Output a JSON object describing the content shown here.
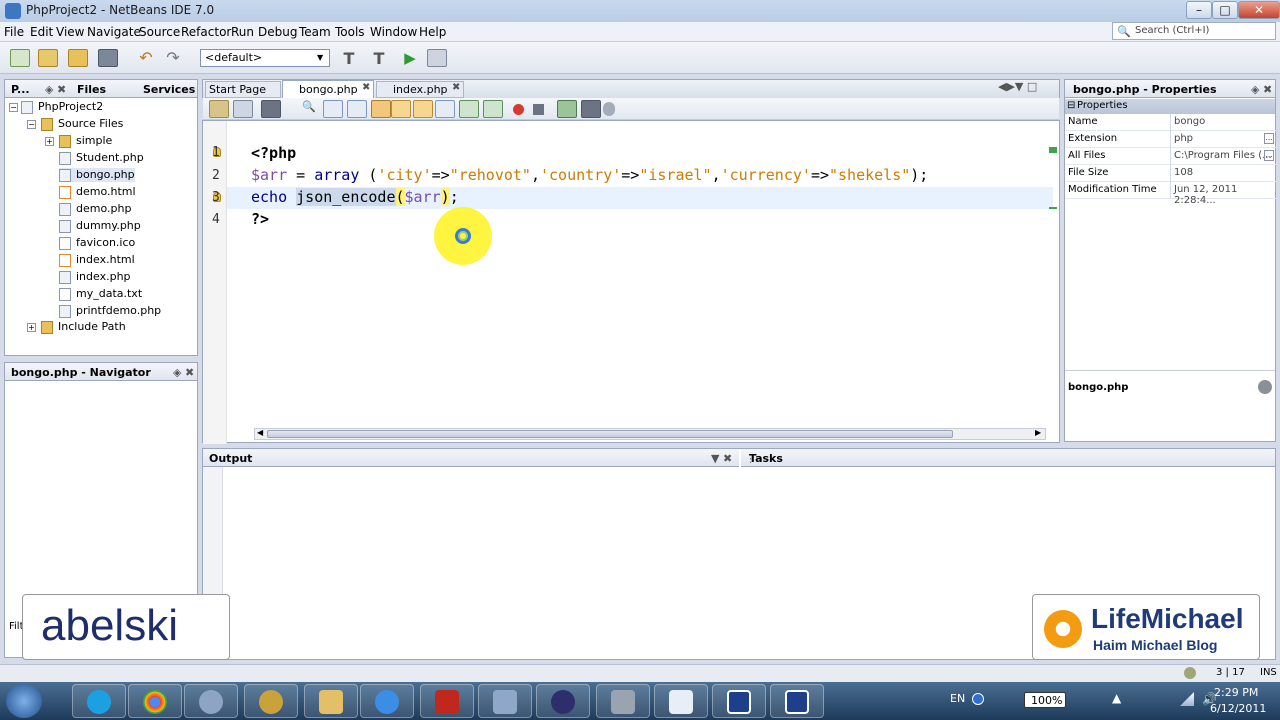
{
  "window": {
    "title": "PhpProject2 - NetBeans IDE 7.0",
    "min": "–",
    "max": "□",
    "close": "✕"
  },
  "menu": [
    "File",
    "Edit",
    "View",
    "Navigate",
    "Source",
    "Refactor",
    "Run",
    "Debug",
    "Team",
    "Tools",
    "Window",
    "Help"
  ],
  "search": {
    "placeholder": "Search (Ctrl+I)"
  },
  "toolbar": {
    "config": "<default>"
  },
  "projects_panel": {
    "tabs": [
      "P...",
      "Files",
      "Services"
    ],
    "project": "PhpProject2",
    "source_files": "Source Files",
    "folder": "simple",
    "files": [
      "Student.php",
      "bongo.php",
      "demo.html",
      "demo.php",
      "dummy.php",
      "favicon.ico",
      "index.html",
      "index.php",
      "my_data.txt",
      "printfdemo.php"
    ],
    "include_path": "Include Path"
  },
  "navigator": {
    "title": "bongo.php - Navigator"
  },
  "filter_label": "Filt",
  "editor": {
    "tabs": [
      "Start Page",
      "bongo.php",
      "index.php"
    ],
    "line_numbers": [
      "1",
      "2",
      "3",
      "4"
    ],
    "code": {
      "l1": "<?php",
      "l2_var": "$arr",
      "l2_eq": " = ",
      "l2_kw": "array",
      "l2_open": " (",
      "l2_s1": "'city'",
      "l2_a1": "=>",
      "l2_s2": "\"rehovot\"",
      "l2_c1": ",",
      "l2_s3": "'country'",
      "l2_a2": "=>",
      "l2_s4": "\"israel\"",
      "l2_c2": ",",
      "l2_s5": "'currency'",
      "l2_a3": "=>",
      "l2_s6": "\"shekels\"",
      "l2_close": ");",
      "l3_kw": "echo",
      "l3_fn": "json_encode",
      "l3_po": "(",
      "l3_var": "$arr",
      "l3_pc": ")",
      "l3_semi": ";",
      "l4": "?>"
    }
  },
  "output": {
    "title": "Output",
    "tasks": "Tasks"
  },
  "properties": {
    "title": "bongo.php - Properties",
    "section": "Properties",
    "rows": [
      {
        "key": "Name",
        "value": "bongo"
      },
      {
        "key": "Extension",
        "value": "php"
      },
      {
        "key": "All Files",
        "value": "C:\\Program Files (..."
      },
      {
        "key": "File Size",
        "value": "108"
      },
      {
        "key": "Modification Time",
        "value": "Jun 12, 2011 2:28:4..."
      }
    ],
    "footer": "bongo.php"
  },
  "status": {
    "position": "3 | 17",
    "mode": "INS"
  },
  "watermarks": {
    "left": "abelski",
    "right_title": "LifeMichael",
    "right_sub": "Haim Michael Blog"
  },
  "tray": {
    "lang": "EN",
    "battery": "100%",
    "time": "2:29 PM",
    "date": "6/12/2011"
  },
  "colors": {
    "title_bar": "#c0d3ec",
    "taskbar": "#2f5175",
    "string": "#ce7b00",
    "keyword": "#00008b",
    "variable": "#7a4ea5",
    "highlight_line": "#e8f2fe",
    "occurrence": "#ccd9ec",
    "brace_match": "#fff27a"
  }
}
